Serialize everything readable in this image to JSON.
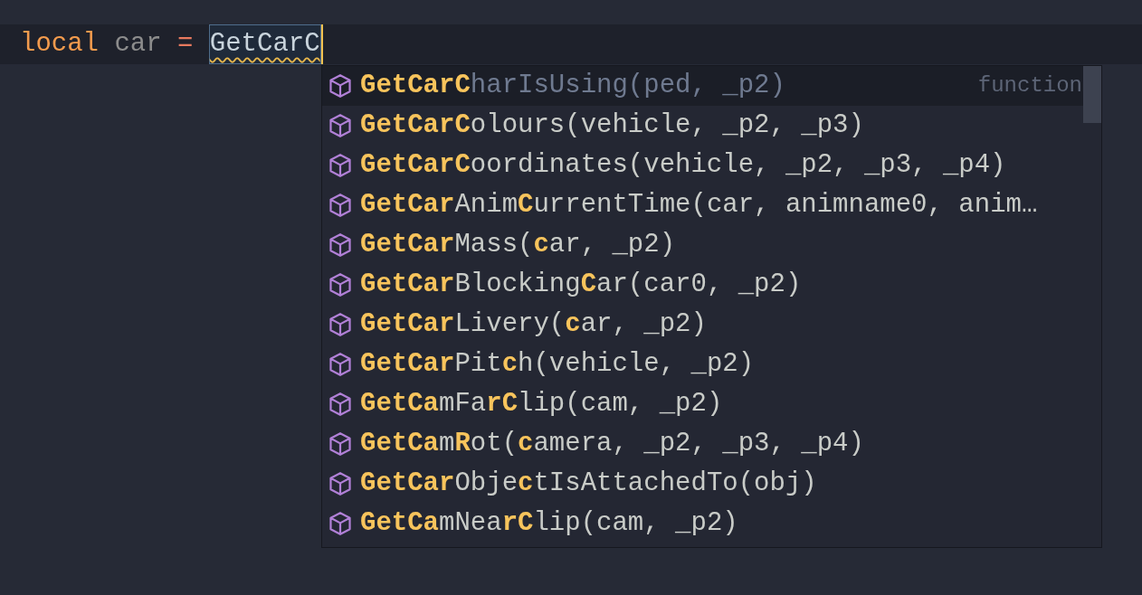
{
  "editor": {
    "line": {
      "tokens": [
        {
          "text": "local",
          "kind": "keyword"
        },
        {
          "text": "car",
          "kind": "identifier"
        },
        {
          "text": "=",
          "kind": "operator"
        },
        {
          "text": "GetCarC",
          "kind": "typed",
          "warning": true,
          "cursor": true
        }
      ]
    }
  },
  "suggestions": {
    "items": [
      {
        "label": "**GetCarC**harIsUsing(ped, _p2)",
        "detail": "function",
        "selected": true
      },
      {
        "label": "**GetCarC**olours(vehicle, _p2, _p3)",
        "selected": false
      },
      {
        "label": "**GetCarC**oordinates(vehicle, _p2, _p3, _p4)",
        "selected": false
      },
      {
        "label": "**GetCar**Anim**C**urrentTime(car, animname0, anim…",
        "selected": false
      },
      {
        "label": "**GetCar**Mass(**c**ar, _p2)",
        "selected": false
      },
      {
        "label": "**GetCar**Blocking**C**ar(car0, _p2)",
        "selected": false
      },
      {
        "label": "**GetCar**Livery(**c**ar, _p2)",
        "selected": false
      },
      {
        "label": "**GetCar**Pit**c**h(vehicle, _p2)",
        "selected": false
      },
      {
        "label": "**GetCa**mFa**rC**lip(cam, _p2)",
        "selected": false
      },
      {
        "label": "**GetCa**m**R**ot(**c**amera, _p2, _p3, _p4)",
        "selected": false
      },
      {
        "label": "**GetCar**Obje**c**tIsAttachedTo(obj)",
        "selected": false
      },
      {
        "label": "**GetCa**mNea**rC**lip(cam, _p2)",
        "selected": false
      }
    ]
  }
}
